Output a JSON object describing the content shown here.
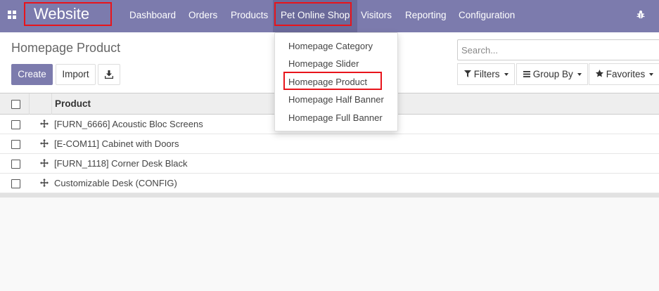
{
  "navbar": {
    "brand": "Website",
    "menus": [
      "Dashboard",
      "Orders",
      "Products",
      "Pet Online Shop",
      "Visitors",
      "Reporting",
      "Configuration"
    ],
    "active_menu": "Pet Online Shop",
    "bg_color": "#7c7bad",
    "icons": [
      "apps-grid-icon",
      "bug-icon"
    ]
  },
  "control_panel": {
    "title": "Homepage Product",
    "create_label": "Create",
    "import_label": "Import",
    "search_placeholder": "Search...",
    "filters_label": "Filters",
    "groupby_label": "Group By",
    "favorites_label": "Favorites"
  },
  "dropdown": {
    "items": [
      "Homepage Category",
      "Homepage Slider",
      "Homepage Product",
      "Homepage Half Banner",
      "Homepage Full Banner"
    ],
    "highlighted": "Homepage Product"
  },
  "list": {
    "column_header": "Product",
    "rows": [
      "[FURN_6666] Acoustic Bloc Screens",
      "[E-COM11] Cabinet with Doors",
      "[FURN_1118] Corner Desk Black",
      "Customizable Desk (CONFIG)"
    ]
  },
  "colors": {
    "accent": "#7c7bad",
    "highlight_box": "#e8141b"
  }
}
